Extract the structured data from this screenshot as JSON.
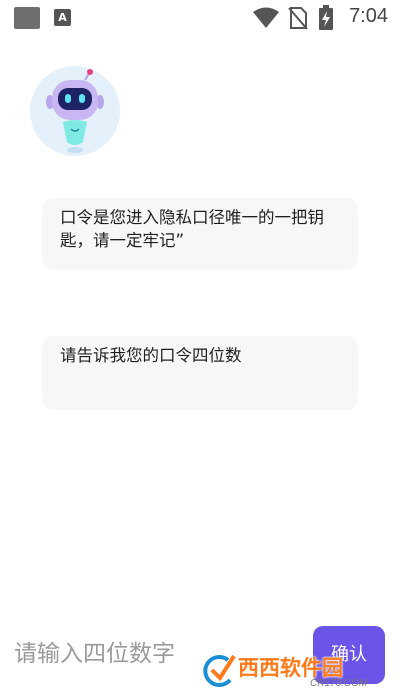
{
  "status_bar": {
    "time": "7:04",
    "notification_letter": "A",
    "icons": [
      "app-notification-icon",
      "text-notification-icon",
      "wifi-icon",
      "no-sim-icon",
      "battery-charging-icon"
    ]
  },
  "chat": {
    "messages": [
      {
        "text": "口令是您进入隐私口径唯一的一把钥匙，请一定牢记”"
      },
      {
        "text": "请告诉我您的口令四位数"
      }
    ]
  },
  "input": {
    "placeholder": "请输入四位数字",
    "confirm_label": "确认"
  },
  "watermark": {
    "text": "西西软件园",
    "sub": "CR173.COM"
  },
  "colors": {
    "accent": "#6a55e8",
    "bubble_bg": "#f7f7f8",
    "watermark": "#ff7a1a"
  }
}
